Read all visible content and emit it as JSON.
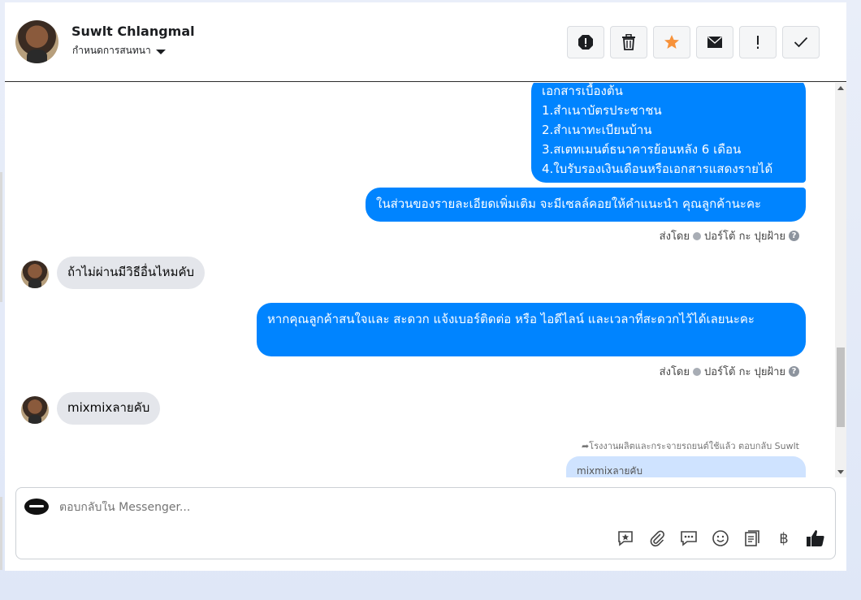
{
  "header": {
    "contact_name": "Suwlt Chlangmal",
    "conversation_label": "กำหนดการสนทนา",
    "toolbar": [
      "report-icon",
      "trash-icon",
      "star-icon",
      "envelope-icon",
      "exclamation-icon",
      "check-icon"
    ]
  },
  "messages": {
    "docs_lines": [
      "เอกสารเบื้องต้น",
      "1.สำเนาบัตรประชาชน",
      "2.สำเนาทะเบียนบ้าน",
      "3.สเตทเมนต์ธนาคารย้อนหลัง 6 เดือน",
      "4.ใบรับรองเงินเดือนหรือเอกสารแสดงรายได้"
    ],
    "details_msg": "ในส่วนของรายละเอียดเพิ่มเติม จะมีเซลล์คอยให้คำแนะนำ คุณลูกค้านะคะ",
    "sent_by_1": "ส่งโดย",
    "sender_1": "ปอร์โต้ กะ ปุยฝ้าย",
    "incoming_1": "ถ้าไม่ผ่านมีวิธีอื่นไหมคับ",
    "interest_msg": "หากคุณลูกค้าสนใจและ สะดวก แจ้งเบอร์ติดต่อ หรือ ไอดีไลน์ และเวลาที่สะดวกไว้ได้เลยนะคะ",
    "sent_by_2": "ส่งโดย",
    "sender_2": "ปอร์โต้ กะ ปุยฝ้าย",
    "incoming_2": "mixmixลายคับ",
    "reply_note": "โรงงานผลิตและกระจายรถยนต์ใช้แล้ว ตอบกลับ Suwlt",
    "reply_quote": "mixmixลายคับ"
  },
  "composer": {
    "placeholder": "ตอบกลับใน Messenger...",
    "currency_symbol": "฿",
    "icons": [
      "saved-reply-icon",
      "attachment-icon",
      "chat-icon",
      "emoji-icon",
      "notes-icon",
      "baht-icon",
      "like-icon"
    ]
  }
}
